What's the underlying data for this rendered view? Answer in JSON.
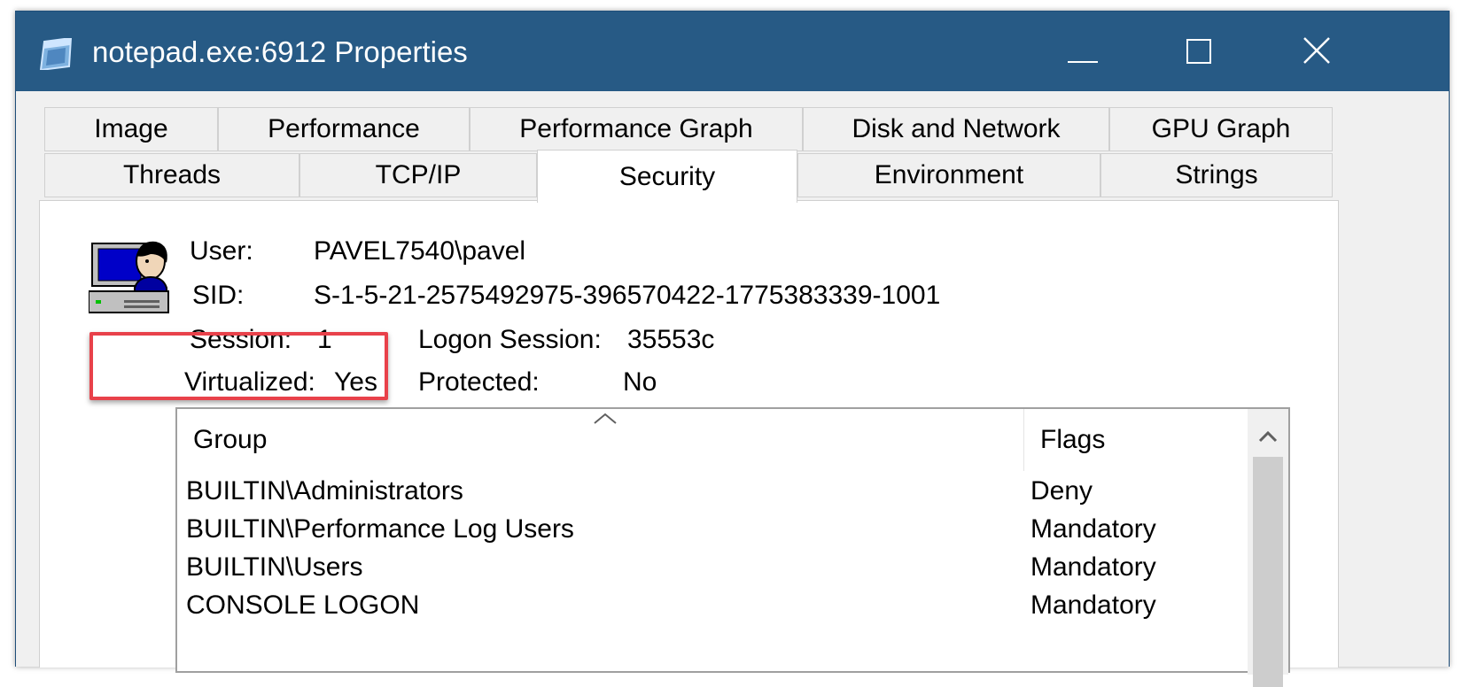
{
  "window": {
    "title": "notepad.exe:6912 Properties"
  },
  "tabs": {
    "row1": [
      "Image",
      "Performance",
      "Performance Graph",
      "Disk and Network",
      "GPU Graph"
    ],
    "row2": [
      "Threads",
      "TCP/IP",
      "Security",
      "Environment",
      "Strings"
    ],
    "active": "Security"
  },
  "security": {
    "user_label": "User:",
    "user_value": "PAVEL7540\\pavel",
    "sid_label": "SID:",
    "sid_value": "S-1-5-21-2575492975-396570422-1775383339-1001",
    "session_label": "Session:",
    "session_value": "1",
    "logon_label": "Logon Session:",
    "logon_value": "35553c",
    "virtualized_label": "Virtualized:",
    "virtualized_value": "Yes",
    "protected_label": "Protected:",
    "protected_value": "No"
  },
  "groups_table": {
    "columns": [
      "Group",
      "Flags"
    ],
    "rows": [
      {
        "group": "BUILTIN\\Administrators",
        "flags": "Deny"
      },
      {
        "group": "BUILTIN\\Performance Log Users",
        "flags": "Mandatory"
      },
      {
        "group": "BUILTIN\\Users",
        "flags": "Mandatory"
      },
      {
        "group": "CONSOLE LOGON",
        "flags": "Mandatory"
      }
    ]
  },
  "colors": {
    "titlebar": "#275a85",
    "highlight": "#e8414a"
  },
  "icons": [
    "app-window-icon",
    "user-computer-icon",
    "minimize-icon",
    "maximize-icon",
    "close-icon",
    "sort-ascending-icon",
    "scroll-up-icon"
  ]
}
